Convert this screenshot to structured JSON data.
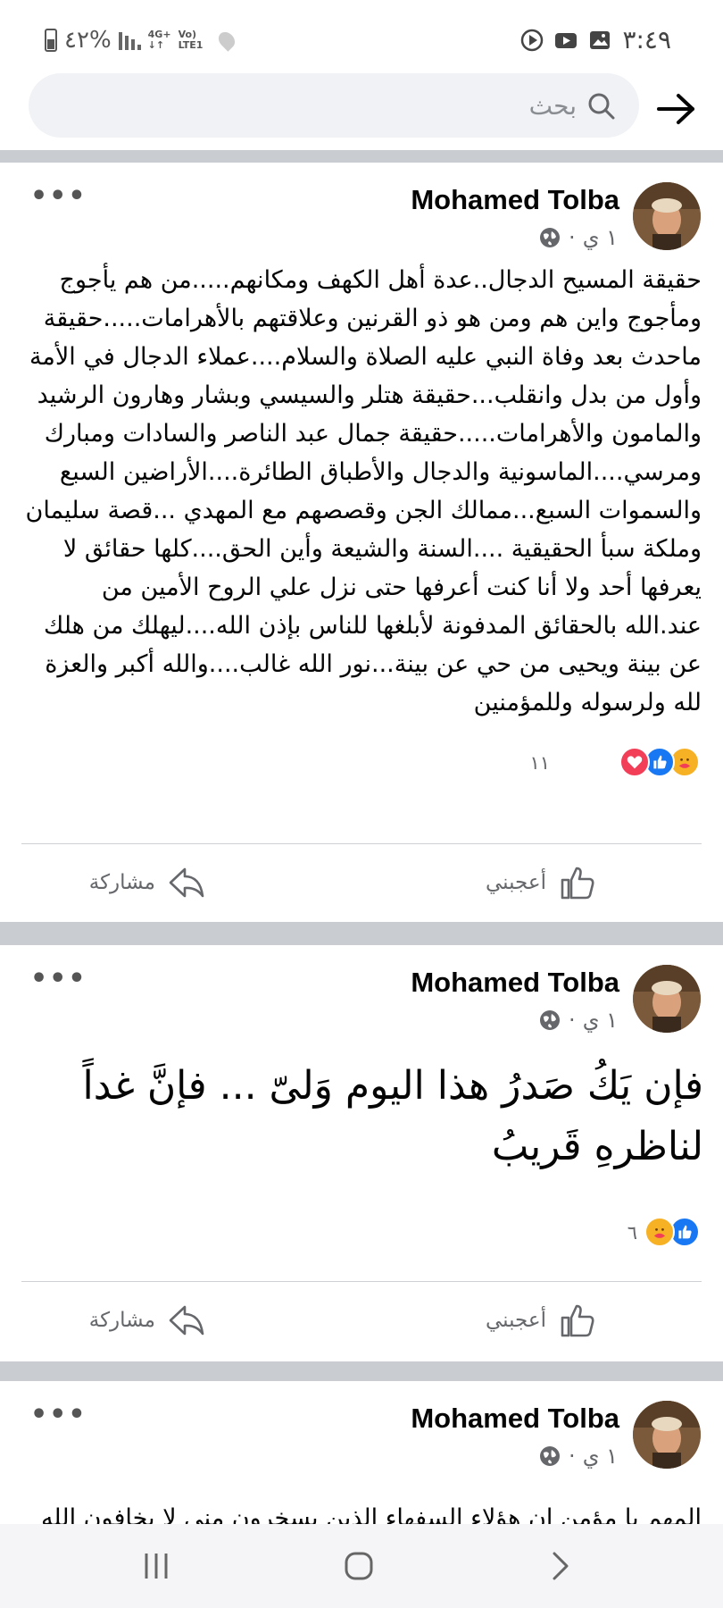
{
  "status_bar": {
    "battery_text": "٤٢%",
    "network": "4G+",
    "volte": "Vo) LTE1",
    "time": "٣:٤٩"
  },
  "search": {
    "placeholder": "بحث"
  },
  "posts": [
    {
      "author": "Mohamed Tolba",
      "time": "١ ي",
      "body": "حقيقة المسيح الدجال..عدة أهل الكهف ومكانهم.....من هم يأجوج ومأجوج واين هم ومن هو ذو القرنين وعلاقتهم بالأهرامات.....حقيقة ماحدث بعد وفاة النبي عليه الصلاة والسلام....عملاء الدجال في الأمة وأول من بدل وانقلب...حقيقة هتلر والسيسي وبشار وهارون الرشيد والمامون والأهرامات.....حقيقة جمال عبد الناصر والسادات ومبارك ومرسي....الماسونية والدجال والأطباق الطائرة....الأراضين السبع والسموات السبع...ممالك الجن وقصصهم مع المهدي ...قصة سليمان وملكة سبأ الحقيقية ....السنة والشيعة وأين الحق....كلها حقائق لا يعرفها أحد ولا أنا كنت أعرفها حتى نزل علي الروح الأمين من عند.الله بالحقائق المدفونة لأبلغها للناس بإذن الله....ليهلك من هلك عن بينة ويحيى من حي عن بينة...نور الله غالب....والله أكبر والعزة لله ولرسوله وللمؤمنين",
      "reaction_count": "١١",
      "reactions": [
        "care",
        "like",
        "love"
      ],
      "like_label": "أعجبني",
      "share_label": "مشاركة"
    },
    {
      "author": "Mohamed Tolba",
      "time": "١ ي",
      "body": "فإن يَكُ صَدرُ هذا اليوم وَلىّ ... فإنَّ غداً لناظرهِ قَريبُ",
      "reaction_count": "٦",
      "reactions": [
        "like",
        "care"
      ],
      "like_label": "أعجبني",
      "share_label": "مشاركة"
    },
    {
      "author": "Mohamed Tolba",
      "time": "١ ي",
      "body": "المهم يا مؤمن إن هؤلاء السفهاء الذين يسخرون مني لا يخافون الله"
    }
  ],
  "colors": {
    "like_blue": "#1877f2",
    "love_red": "#f33e58",
    "care_yellow": "#f7b125",
    "divider": "#c9ccd1"
  }
}
